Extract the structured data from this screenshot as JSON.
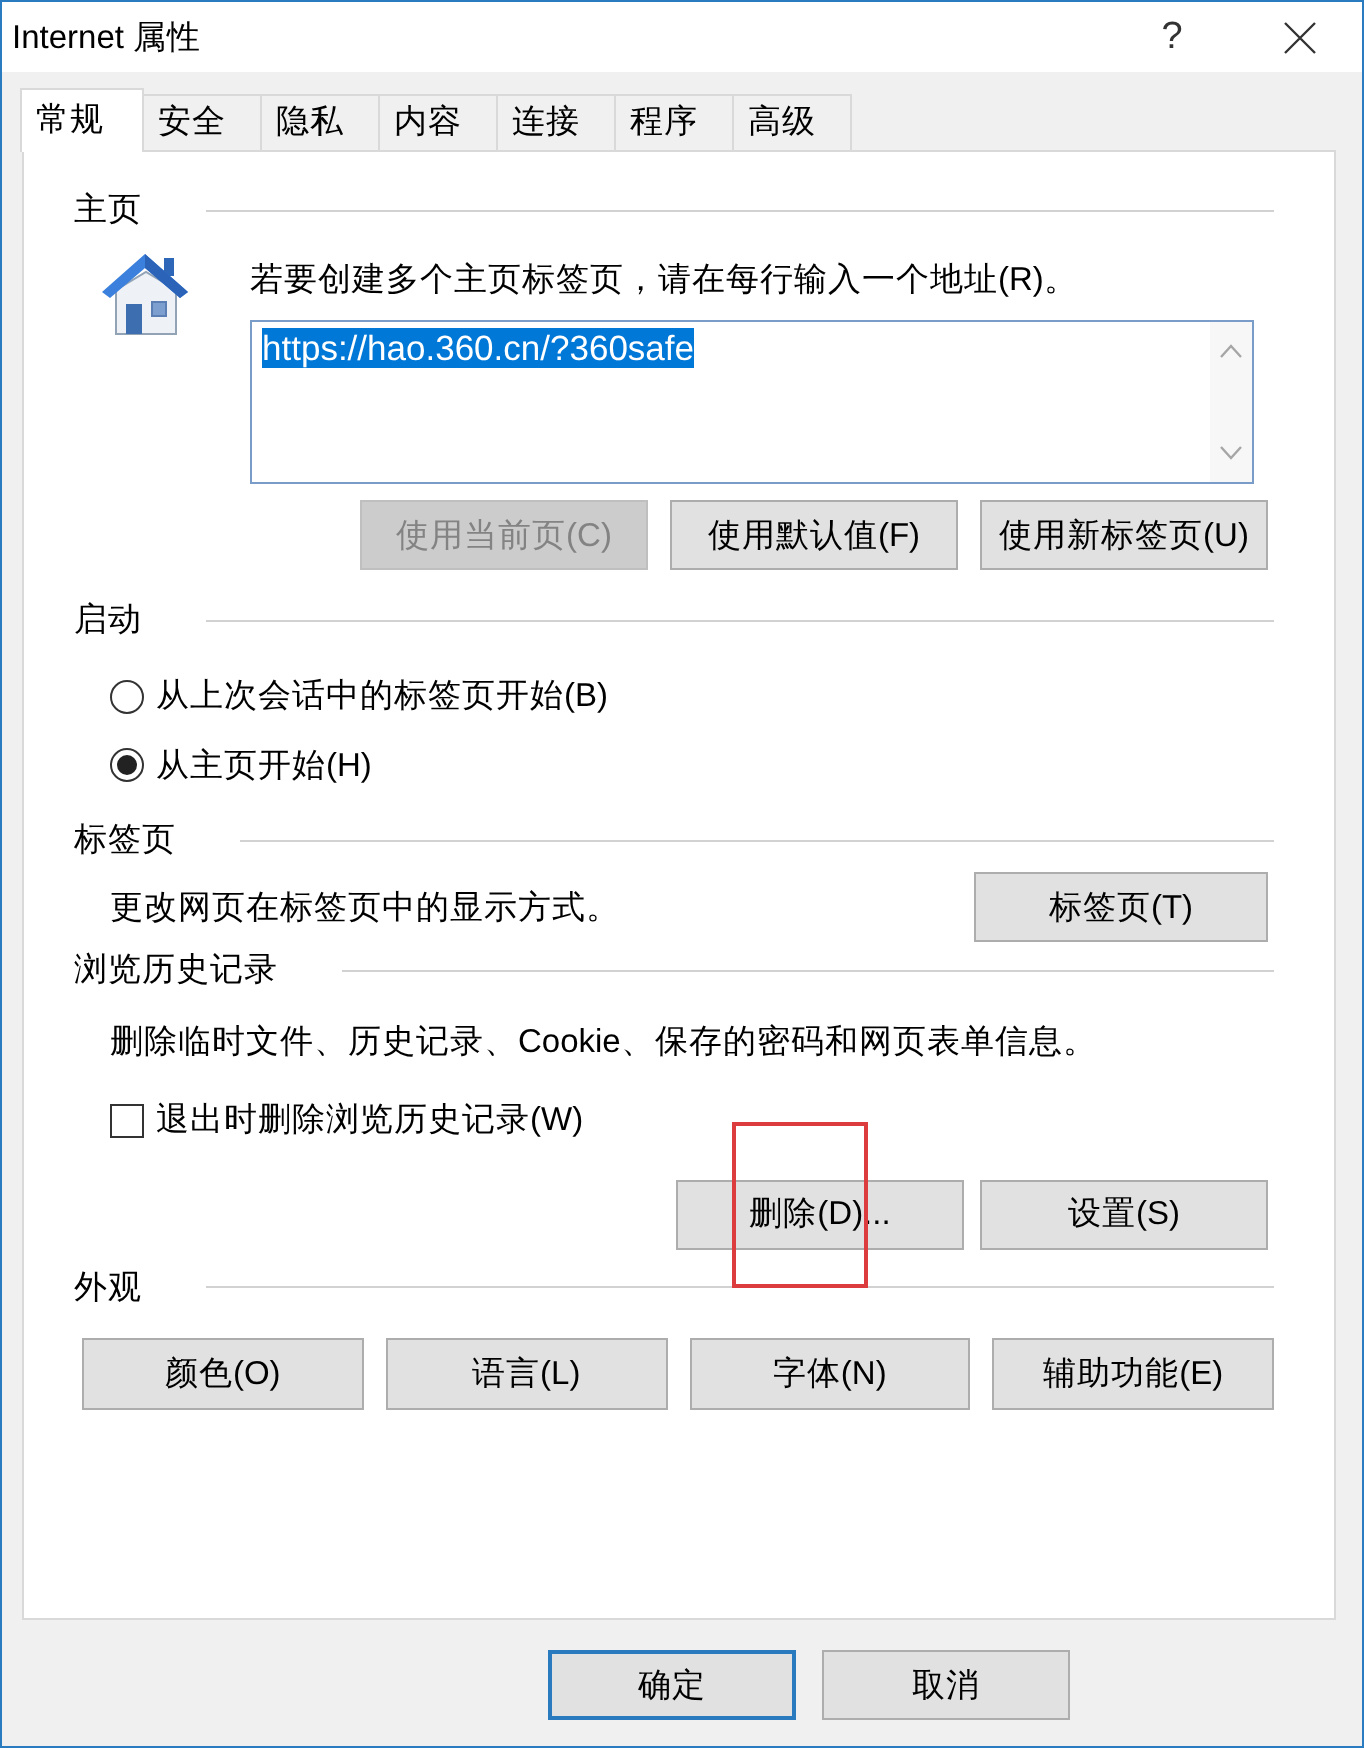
{
  "window": {
    "title": "Internet 属性",
    "help": "?"
  },
  "tabs": [
    {
      "label": "常规",
      "selected": true
    },
    {
      "label": "安全",
      "selected": false
    },
    {
      "label": "隐私",
      "selected": false
    },
    {
      "label": "内容",
      "selected": false
    },
    {
      "label": "连接",
      "selected": false
    },
    {
      "label": "程序",
      "selected": false
    },
    {
      "label": "高级",
      "selected": false
    }
  ],
  "home_page": {
    "heading": "主页",
    "instruction": "若要创建多个主页标签页，请在每行输入一个地址(R)。",
    "value": "https://hao.360.cn/?360safe",
    "value_selected": true,
    "buttons": [
      {
        "label": "使用当前页(C)",
        "disabled": true
      },
      {
        "label": "使用默认值(F)",
        "disabled": false
      },
      {
        "label": "使用新标签页(U)",
        "disabled": false
      }
    ]
  },
  "startup": {
    "heading": "启动",
    "options": [
      {
        "label": "从上次会话中的标签页开始(B)",
        "selected": false
      },
      {
        "label": "从主页开始(H)",
        "selected": true
      }
    ]
  },
  "tabs_settings": {
    "heading": "标签页",
    "description": "更改网页在标签页中的显示方式。",
    "button": "标签页(T)"
  },
  "browsing_history": {
    "heading": "浏览历史记录",
    "description": "删除临时文件、历史记录、Cookie、保存的密码和网页表单信息。",
    "checkbox": {
      "label": "退出时删除浏览历史记录(W)",
      "checked": false
    },
    "buttons": [
      {
        "label": "删除(D)...",
        "highlighted": true
      },
      {
        "label": "设置(S)",
        "highlighted": false
      }
    ]
  },
  "appearance": {
    "heading": "外观",
    "buttons": [
      "颜色(O)",
      "语言(L)",
      "字体(N)",
      "辅助功能(E)"
    ]
  },
  "dialog_buttons": [
    {
      "label": "确定",
      "default": true
    },
    {
      "label": "取消",
      "default": false
    }
  ]
}
